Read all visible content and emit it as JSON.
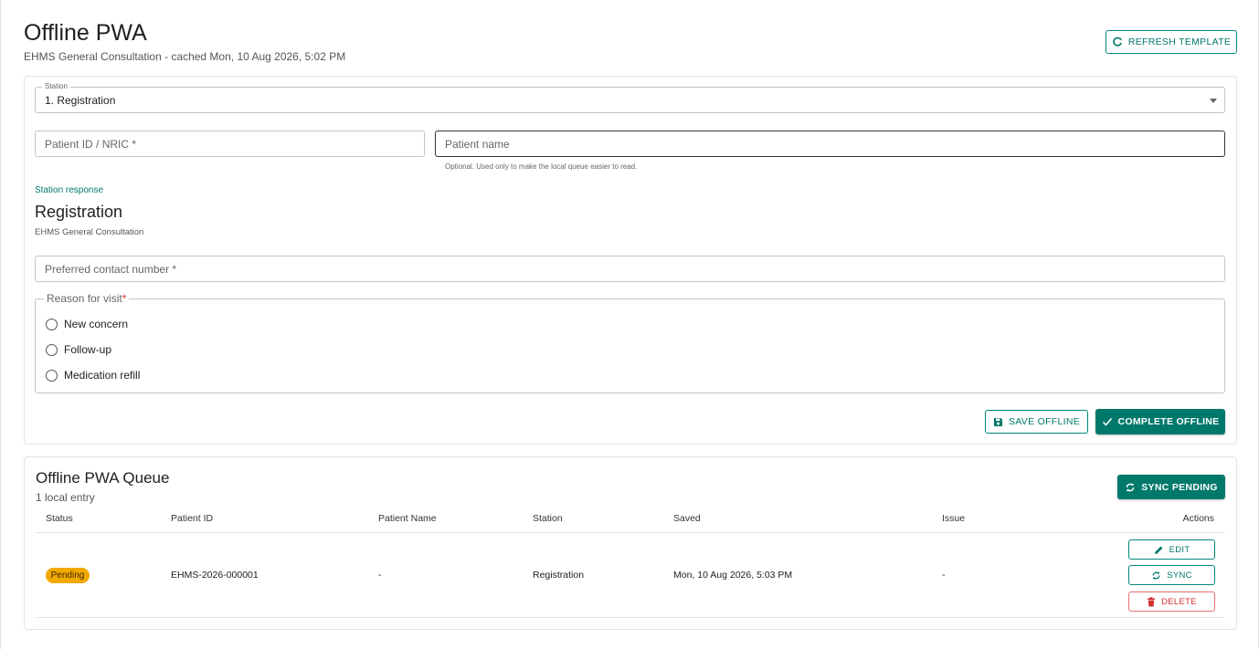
{
  "header": {
    "title": "Offline PWA",
    "subtitle": "EHMS General Consultation - cached Mon, 10 Aug 2026, 5:02 PM",
    "refresh_label": "REFRESH TEMPLATE"
  },
  "form": {
    "station": {
      "label": "Station",
      "value": "1. Registration"
    },
    "patient_id": {
      "placeholder": "Patient ID / NRIC *"
    },
    "patient_name": {
      "placeholder": "Patient name",
      "helper": "Optional. Used only to make the local queue easier to read."
    },
    "response_label": "Station response",
    "section_title": "Registration",
    "section_subtitle": "EHMS General Consultation",
    "contact": {
      "placeholder": "Preferred contact number *"
    },
    "reason": {
      "legend": "Reason for visit",
      "required_mark": "*",
      "options": [
        "New concern",
        "Follow-up",
        "Medication refill"
      ]
    },
    "save_label": "SAVE OFFLINE",
    "complete_label": "COMPLETE OFFLINE"
  },
  "queue": {
    "title": "Offline PWA Queue",
    "count_text": "1 local entry",
    "sync_pending_label": "SYNC PENDING",
    "columns": [
      "Status",
      "Patient ID",
      "Patient Name",
      "Station",
      "Saved",
      "Issue",
      "Actions"
    ],
    "rows": [
      {
        "status": "Pending",
        "patient_id": "EHMS-2026-000001",
        "patient_name": "-",
        "station": "Registration",
        "saved": "Mon, 10 Aug 2026, 5:03 PM",
        "issue": "-",
        "actions": {
          "edit": "EDIT",
          "sync": "SYNC",
          "delete": "DELETE"
        }
      }
    ]
  },
  "colors": {
    "primary": "#00796b",
    "pending": "#f2a900",
    "danger": "#d32f2f"
  },
  "icons": [
    "refresh-icon",
    "caret-down-icon",
    "save-icon",
    "check-icon",
    "sync-icon",
    "pencil-icon",
    "trash-icon"
  ]
}
